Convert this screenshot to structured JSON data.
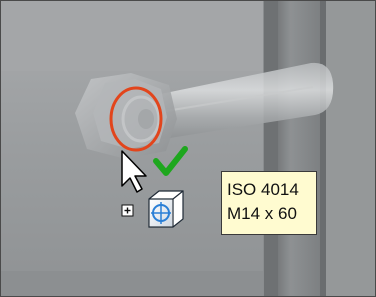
{
  "tooltip": {
    "line1": "ISO 4014",
    "line2": "M14 x 60"
  },
  "icons": {
    "cursor": "arrow-pointer-icon",
    "accept": "green-checkmark-icon",
    "expand": "plus-box-icon",
    "placement": "blue-cube-crosshair-icon",
    "hole_highlight": "red-circle-highlight"
  },
  "colors": {
    "checkmark": "#1ea71e",
    "highlight": "#e2451c",
    "tooltip_bg": "#fffbd0",
    "cube": "#2a7fd6"
  }
}
